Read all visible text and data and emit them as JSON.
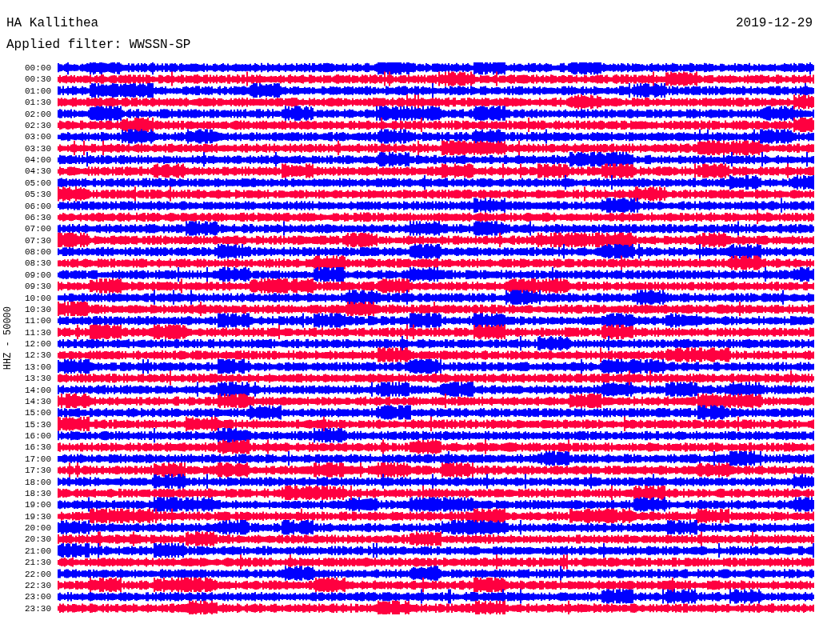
{
  "station": "HA Kallithea",
  "filter": "Applied filter: WWSSN-SP",
  "date": "2019-12-29",
  "axis_label": "HHZ - 50000",
  "traces": [
    {
      "time": "00:00",
      "color": "#0000ff"
    },
    {
      "time": "00:30",
      "color": "#ff0040"
    },
    {
      "time": "01:00",
      "color": "#0000ff"
    },
    {
      "time": "01:30",
      "color": "#ff0040"
    },
    {
      "time": "02:00",
      "color": "#0000ff"
    },
    {
      "time": "02:30",
      "color": "#ff0040"
    },
    {
      "time": "03:00",
      "color": "#0000ff"
    },
    {
      "time": "03:30",
      "color": "#ff0040"
    },
    {
      "time": "04:00",
      "color": "#0000ff"
    },
    {
      "time": "04:30",
      "color": "#ff0040"
    },
    {
      "time": "05:00",
      "color": "#0000ff"
    },
    {
      "time": "05:30",
      "color": "#ff0040"
    },
    {
      "time": "06:00",
      "color": "#0000ff"
    },
    {
      "time": "06:30",
      "color": "#ff0040"
    },
    {
      "time": "07:00",
      "color": "#0000ff"
    },
    {
      "time": "07:30",
      "color": "#ff0040"
    },
    {
      "time": "08:00",
      "color": "#0000ff"
    },
    {
      "time": "08:30",
      "color": "#ff0040"
    },
    {
      "time": "09:00",
      "color": "#0000ff"
    },
    {
      "time": "09:30",
      "color": "#ff0040"
    },
    {
      "time": "10:00",
      "color": "#0000ff"
    },
    {
      "time": "10:30",
      "color": "#ff0040"
    },
    {
      "time": "11:00",
      "color": "#0000ff"
    },
    {
      "time": "11:30",
      "color": "#ff0040"
    },
    {
      "time": "12:00",
      "color": "#0000ff"
    },
    {
      "time": "12:30",
      "color": "#ff0040"
    },
    {
      "time": "13:00",
      "color": "#0000ff"
    },
    {
      "time": "13:30",
      "color": "#ff0040"
    },
    {
      "time": "14:00",
      "color": "#0000ff"
    },
    {
      "time": "14:30",
      "color": "#ff0040"
    },
    {
      "time": "15:00",
      "color": "#0000ff"
    },
    {
      "time": "15:30",
      "color": "#ff0040"
    },
    {
      "time": "16:00",
      "color": "#0000ff"
    },
    {
      "time": "16:30",
      "color": "#ff0040"
    },
    {
      "time": "17:00",
      "color": "#0000ff"
    },
    {
      "time": "17:30",
      "color": "#ff0040"
    },
    {
      "time": "18:00",
      "color": "#0000ff"
    },
    {
      "time": "18:30",
      "color": "#ff0040"
    },
    {
      "time": "19:00",
      "color": "#0000ff"
    },
    {
      "time": "19:30",
      "color": "#ff0040"
    },
    {
      "time": "20:00",
      "color": "#0000ff"
    },
    {
      "time": "20:30",
      "color": "#ff0040"
    },
    {
      "time": "21:00",
      "color": "#0000ff"
    },
    {
      "time": "21:30",
      "color": "#ff0040"
    },
    {
      "time": "22:00",
      "color": "#0000ff"
    },
    {
      "time": "22:30",
      "color": "#ff0040"
    },
    {
      "time": "23:00",
      "color": "#0000ff"
    },
    {
      "time": "23:30",
      "color": "#ff0040"
    }
  ]
}
